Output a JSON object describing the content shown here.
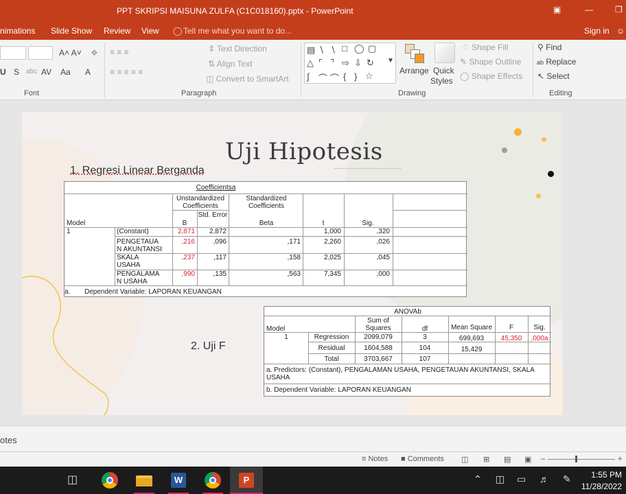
{
  "window": {
    "title": "PPT SKRIPSI MAISUNA ZULFA (C1C018160).pptx - PowerPoint"
  },
  "tabs": [
    "nimations",
    "Slide Show",
    "Review",
    "View"
  ],
  "tell_me": "Tell me what you want to do...",
  "sign_in": "Sign in",
  "ribbon": {
    "groups": {
      "font": "Font",
      "paragraph": "Paragraph",
      "drawing": "Drawing",
      "editing": "Editing"
    },
    "text_direction": "Text Direction",
    "align_text": "Align Text",
    "convert_smartart": "Convert to SmartArt",
    "arrange": "Arrange",
    "quick": "Quick",
    "styles": "Styles",
    "shape_fill": "Shape Fill",
    "shape_outline": "Shape Outline",
    "shape_effects": "Shape Effects",
    "find": "Find",
    "replace": "Replace",
    "select": "Select"
  },
  "slide": {
    "title": "Uji Hipotesis",
    "heading1": "1. Regresi Linear Berganda",
    "heading2": "2. Uji F",
    "coeff_table": {
      "caption": "Coefficientsa",
      "h_unstd": "Unstandardized Coefficients",
      "h_std": "Standardized Coefficients",
      "h_model": "Model",
      "h_b": "B",
      "h_se": "Std. Error",
      "h_beta": "Beta",
      "h_t": "t",
      "h_sig": "Sig.",
      "rows": [
        {
          "model": "1",
          "name": "(Constant)",
          "b": "2,871",
          "se": "2,872",
          "beta": "",
          "t": "1,000",
          "sig": ",320"
        },
        {
          "model": "",
          "name": "PENGETAUA N AKUNTANSI",
          "b": ",216",
          "se": ",096",
          "beta": ",171",
          "t": "2,260",
          "sig": ",026"
        },
        {
          "model": "",
          "name": "SKALA USAHA",
          "b": ",237",
          "se": ",117",
          "beta": ",158",
          "t": "2,025",
          "sig": ",045"
        },
        {
          "model": "",
          "name": "PENGALAMA N USAHA",
          "b": ",990",
          "se": ",135",
          "beta": ",563",
          "t": "7,345",
          "sig": ",000"
        }
      ],
      "footnote_a": "a.",
      "footnote": "Dependent Variable: LAPORAN KEUANGAN"
    },
    "anova_table": {
      "caption": "ANOVAb",
      "h_model": "Model",
      "h_ss": "Sum of Squares",
      "h_df": "df",
      "h_ms": "Mean Square",
      "h_f": "F",
      "h_sig": "Sig.",
      "model": "1",
      "rows": [
        {
          "name": "Regression",
          "ss": "2099,079",
          "df": "3",
          "ms": "699,693",
          "f": "45,350",
          "sig": ",000a"
        },
        {
          "name": "Residual",
          "ss": "1604,588",
          "df": "104",
          "ms": "15,429",
          "f": "",
          "sig": ""
        },
        {
          "name": "Total",
          "ss": "3703,667",
          "df": "107",
          "ms": "",
          "f": "",
          "sig": ""
        }
      ],
      "note_a": "a. Predictors: (Constant), PENGALAMAN USAHA, PENGETAUAN AKUNTANSI, SKALA USAHA",
      "note_b": "b. Dependent Variable: LAPORAN KEUANGAN"
    }
  },
  "notes_label": "otes",
  "status": {
    "notes": "Notes",
    "comments": "Comments"
  },
  "clock": {
    "time": "1:55 PM",
    "date": "11/28/2022"
  },
  "colors": {
    "accent": "#c43e1c",
    "red_value": "#d22233",
    "dot_yellow": "#f2b431",
    "dot_gray": "#9aa38a",
    "dot_black": "#111111"
  }
}
